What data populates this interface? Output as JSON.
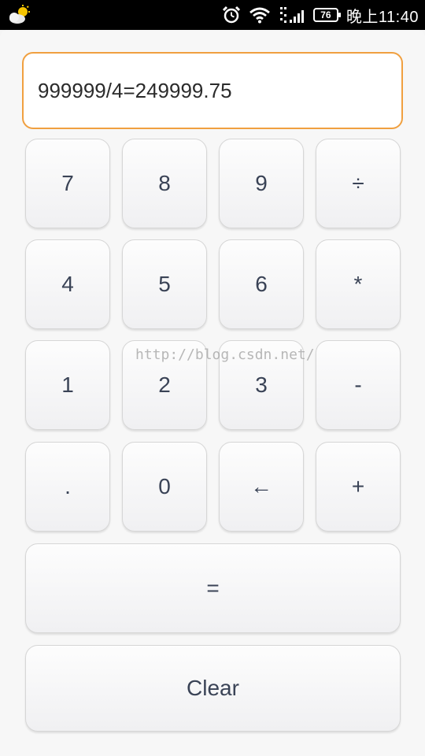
{
  "status_bar": {
    "battery_level": "76",
    "time": "晚上11:40",
    "icons": [
      "weather-icon",
      "alarm-clock-icon",
      "wifi-icon",
      "signal-icon",
      "battery-icon"
    ]
  },
  "calculator": {
    "display_text": "999999/4=249999.75",
    "keys": {
      "k7": "7",
      "k8": "8",
      "k9": "9",
      "divide": "÷",
      "k4": "4",
      "k5": "5",
      "k6": "6",
      "multiply": "*",
      "k1": "1",
      "k2": "2",
      "k3": "3",
      "minus": "-",
      "dot": ".",
      "k0": "0",
      "backspace": "←",
      "plus": "+",
      "equals": "=",
      "clear": "Clear"
    }
  },
  "watermark": "http://blog.csdn.net/",
  "colors": {
    "display_border": "#f0a040",
    "key_text": "#3a4356",
    "status_bar_bg": "#000000"
  }
}
